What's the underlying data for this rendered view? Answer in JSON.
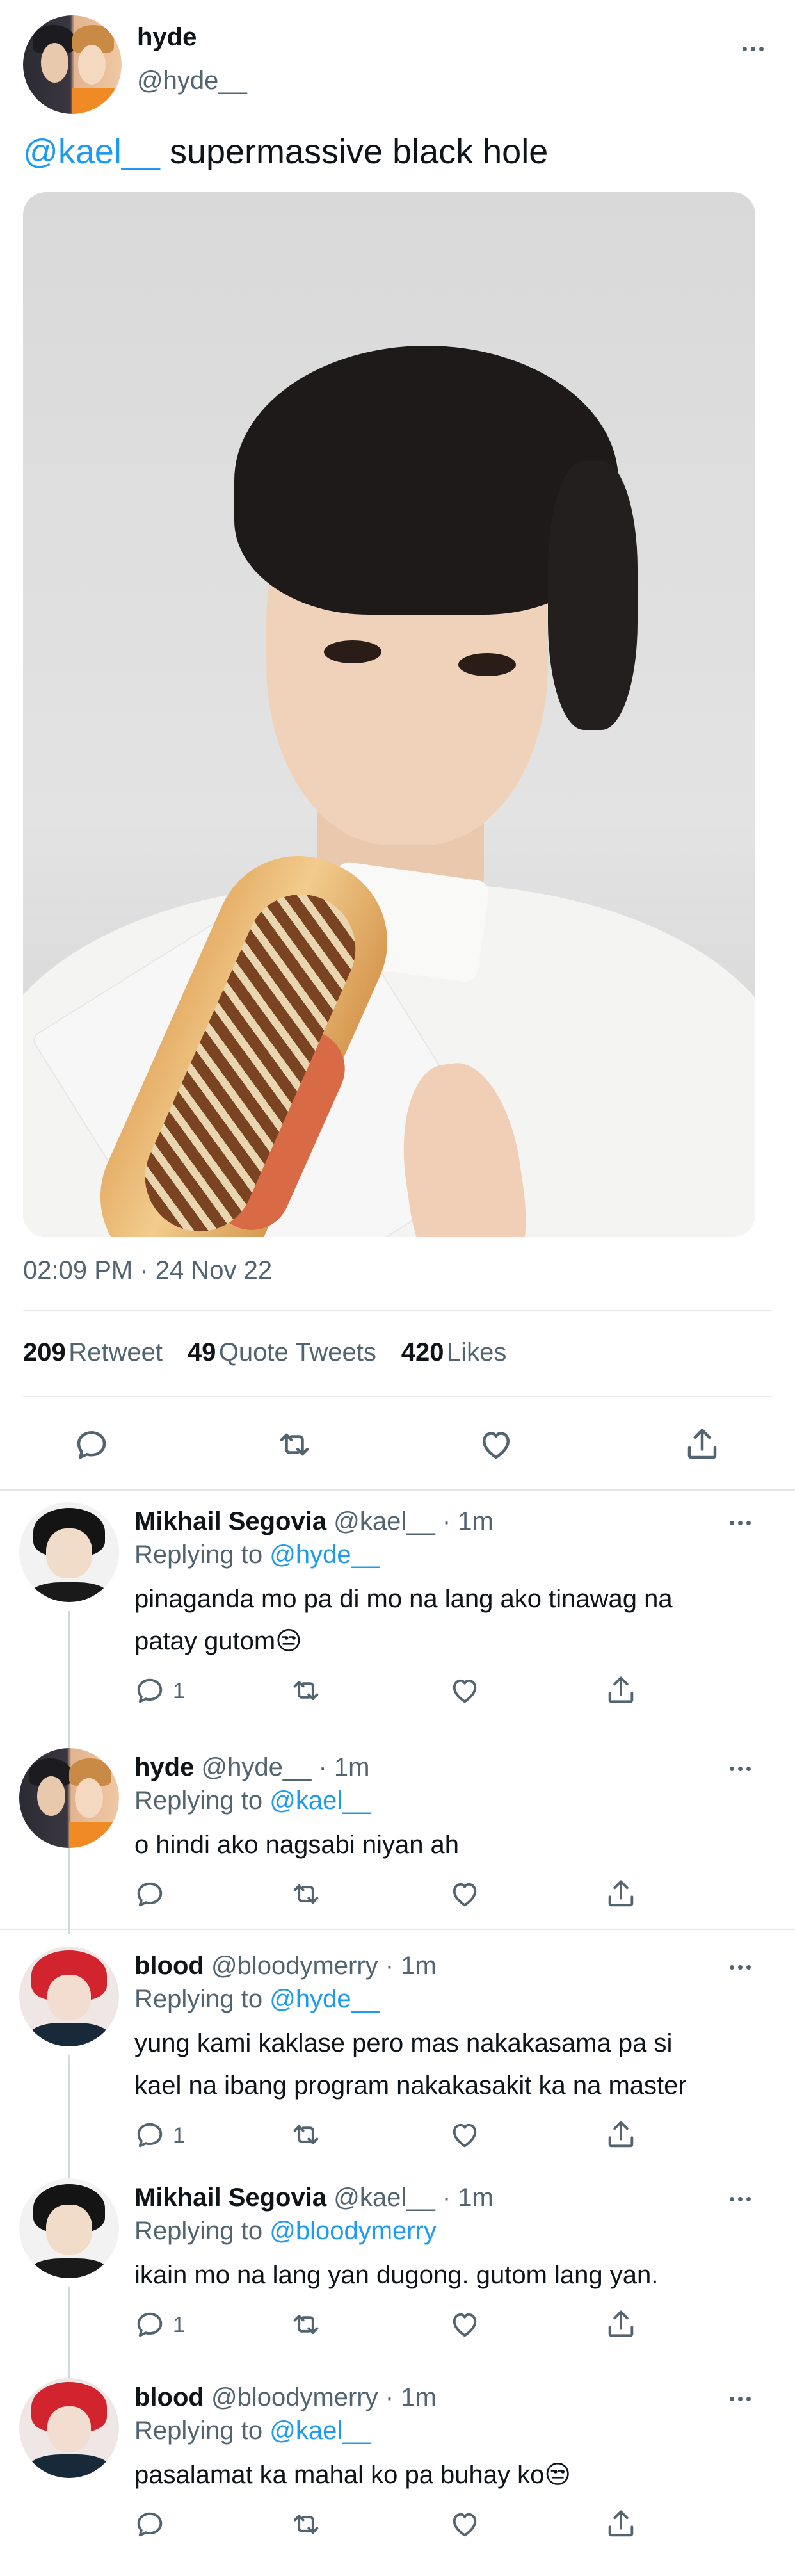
{
  "tweet": {
    "author_name": "hyde",
    "author_handle": "@hyde__",
    "mention": "@kael__",
    "text": " supermassive black hole",
    "timestamp": "02:09 PM · 24 Nov 22",
    "stats": {
      "retweets": "209",
      "retweets_label": "Retweet",
      "quotes": "49",
      "quotes_label": "Quote Tweets",
      "likes": "420",
      "likes_label": "Likes"
    }
  },
  "replies": [
    {
      "name": "Mikhail Segovia",
      "handle": "@kael__",
      "time": "· 1m",
      "replying_label": "Replying to",
      "replying_to": "@hyde__",
      "text_line1": "pinaganda mo pa di mo na lang ako tinawag na",
      "text_line2": "patay gutom😒",
      "reply_count": "1",
      "avatar": "mikhail"
    },
    {
      "name": "hyde",
      "handle": "@hyde__",
      "time": "· 1m",
      "replying_label": "Replying to",
      "replying_to": "@kael__",
      "text_line1": "o hindi ako nagsabi niyan ah",
      "text_line2": "",
      "reply_count": "",
      "avatar": "duo"
    },
    {
      "name": "blood",
      "handle": "@bloodymerry",
      "time": "· 1m",
      "replying_label": "Replying to",
      "replying_to": "@hyde__",
      "text_line1": "yung kami kaklase pero mas nakakasama pa si",
      "text_line2": "kael na ibang program nakakasakit ka na master",
      "reply_count": "1",
      "avatar": "blood"
    },
    {
      "name": "Mikhail Segovia",
      "handle": "@kael__",
      "time": "· 1m",
      "replying_label": "Replying to",
      "replying_to": "@bloodymerry",
      "text_line1": "ikain mo na lang yan dugong. gutom lang yan.",
      "text_line2": "",
      "reply_count": "1",
      "avatar": "mikhail"
    },
    {
      "name": "blood",
      "handle": "@bloodymerry",
      "time": "· 1m",
      "replying_label": "Replying to",
      "replying_to": "@kael__",
      "text_line1": "pasalamat ka mahal ko pa buhay ko😒",
      "text_line2": "",
      "reply_count": "",
      "avatar": "blood"
    }
  ],
  "icons": [
    "more-icon",
    "reply-icon",
    "retweet-icon",
    "like-icon",
    "share-icon"
  ],
  "colors": {
    "link": "#1d9bf0",
    "muted": "#536471",
    "text": "#0f1419",
    "divider": "#e6e9eb"
  }
}
